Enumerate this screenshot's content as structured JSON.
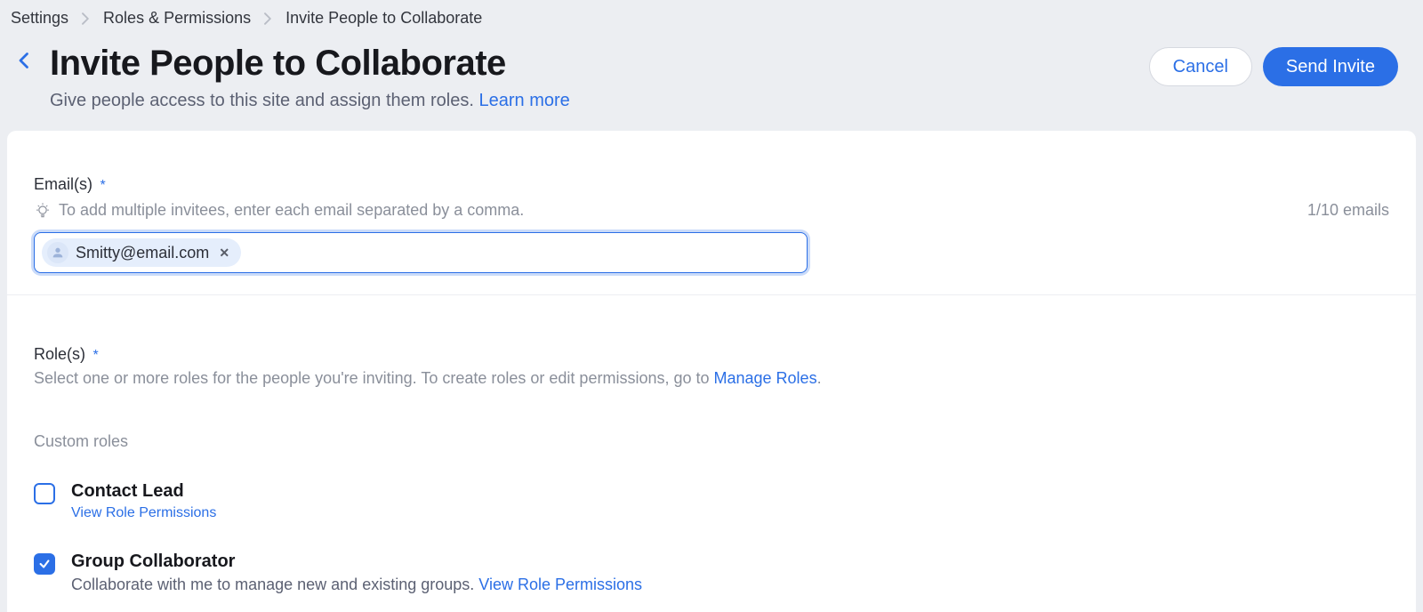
{
  "breadcrumb": {
    "items": [
      "Settings",
      "Roles & Permissions",
      "Invite People to Collaborate"
    ]
  },
  "header": {
    "title": "Invite People to Collaborate",
    "subtitle_prefix": "Give people access to this site and assign them roles. ",
    "learn_more": "Learn more",
    "cancel_label": "Cancel",
    "send_label": "Send Invite"
  },
  "emails": {
    "label": "Email(s)",
    "required_mark": "*",
    "hint": "To add multiple invitees, enter each email separated by a comma.",
    "count_text": "1/10 emails",
    "chips": [
      {
        "email": "Smitty@email.com"
      }
    ]
  },
  "roles": {
    "label": "Role(s)",
    "required_mark": "*",
    "desc_prefix": "Select one or more roles for the people you're inviting. To create roles or edit permissions, go to ",
    "manage_link": "Manage Roles",
    "desc_suffix": ".",
    "custom_heading": "Custom roles",
    "items": [
      {
        "name": "Contact Lead",
        "checked": false,
        "desc": "",
        "view_link": "View Role Permissions"
      },
      {
        "name": "Group Collaborator",
        "checked": true,
        "desc": "Collaborate with me to manage new and existing groups.  ",
        "view_link": "View Role Permissions"
      }
    ]
  }
}
